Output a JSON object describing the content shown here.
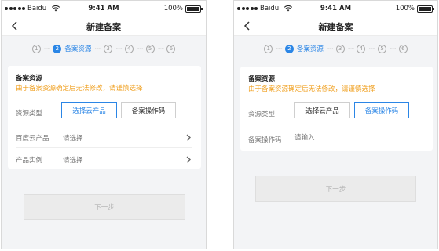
{
  "status_bar": {
    "carrier": "Baidu",
    "time": "9:41 AM",
    "battery": "100%"
  },
  "nav": {
    "title": "新建备案"
  },
  "steps": {
    "labels": [
      "1",
      "2",
      "3",
      "4",
      "5",
      "6"
    ],
    "active_label": "备案资源"
  },
  "card": {
    "title": "备案资源",
    "warning": "由于备案资源确定后无法修改，请谨慎选择",
    "resource_type_label": "资源类型",
    "option_cloud": "选择云产品",
    "option_code": "备案操作码"
  },
  "left_screen": {
    "selected_option": "选择云产品",
    "rows": [
      {
        "label": "百度云产品",
        "value": "请选择"
      },
      {
        "label": "产品实例",
        "value": "请选择"
      }
    ]
  },
  "right_screen": {
    "selected_option": "备案操作码",
    "code_label": "备案操作码",
    "code_placeholder": "请输入"
  },
  "button": {
    "next": "下一步"
  },
  "colors": {
    "accent": "#2b86e6",
    "warning": "#f0a020"
  }
}
